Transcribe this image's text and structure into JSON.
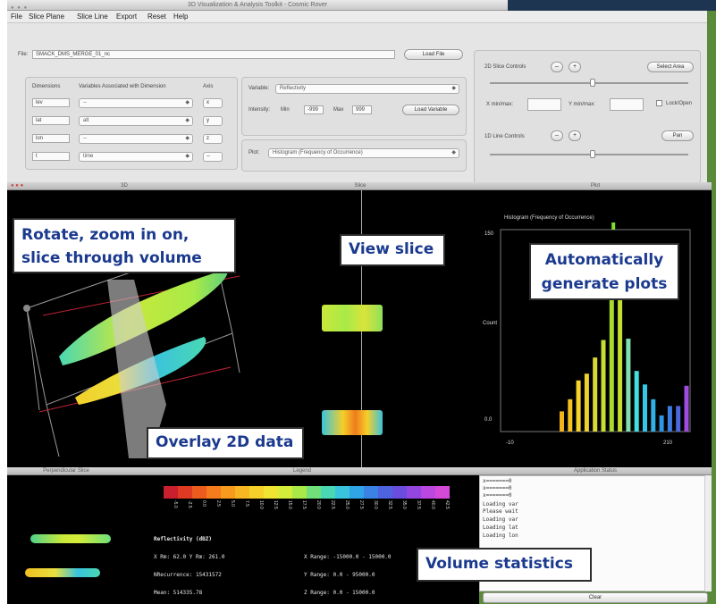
{
  "window": {
    "title": "3D Visualization & Analysis Toolkit - Cosmic Rover"
  },
  "menu": [
    "File",
    "Slice Plane",
    "Slice Line",
    "Export",
    "Reset",
    "Help"
  ],
  "file": {
    "label": "File:",
    "value": "SMACK_DMS_MERGE_01_nc",
    "load_button": "Load File"
  },
  "dims": {
    "header_dimensions": "Dimensions",
    "header_variables": "Variables Associated with Dimension",
    "header_axis": "Axis",
    "rows": [
      {
        "dim": "lev",
        "var": "--",
        "axis": "x"
      },
      {
        "dim": "lat",
        "var": "alt",
        "axis": "y"
      },
      {
        "dim": "lon",
        "var": "--",
        "axis": "z"
      },
      {
        "dim": "t",
        "var": "time",
        "axis": "--"
      }
    ]
  },
  "variable": {
    "label": "Variable:",
    "value": "Reflectivity",
    "intensity_label": "Intensity:",
    "min_label": "Min",
    "min_value": "-999",
    "max_label": "Max",
    "max_value": "999",
    "load_button": "Load Variable"
  },
  "plot": {
    "label": "Plot:",
    "value": "Histogram (Frequency of Occurrence)"
  },
  "slice2d": {
    "label": "2D Slice Controls",
    "minus": "–",
    "plus": "+",
    "button": "Select Area",
    "xmin_label": "X min/max:",
    "ymin_label": "Y min/max:",
    "lock_label": "Lock/Open"
  },
  "line1d": {
    "label": "1D Line Controls",
    "minus": "–",
    "plus": "+",
    "button": "Pan"
  },
  "panels": {
    "view3d": "3D",
    "slice": "Slice",
    "plot": "Plot",
    "perp": "Perpendicular Slice",
    "legend": "Legend",
    "status": "Application Status"
  },
  "histogram": {
    "title": "Histogram (Frequency of Occurrence)",
    "ylabel": "Count",
    "ytick_top": "150",
    "ytick_bottom": "0.0",
    "xtick_left": "-10",
    "xtick_right": "210"
  },
  "chart_data": {
    "type": "bar",
    "title": "Histogram (Frequency of Occurrence)",
    "ylabel": "Count",
    "xlim": [
      -10,
      210
    ],
    "ylim": [
      0,
      150
    ],
    "values": [
      15,
      24,
      38,
      43,
      55,
      68,
      131,
      131,
      69,
      45,
      35,
      24,
      12,
      19,
      19,
      34
    ],
    "colors": [
      "#f2b21a",
      "#f5c21f",
      "#f7d42a",
      "#ecd130",
      "#d9d936",
      "#c9de33",
      "#a8d92e",
      "#c3e02c",
      "#7fe0b0",
      "#43e0e0",
      "#33c8e8",
      "#2fb1e6",
      "#2d96e6",
      "#3b7de2",
      "#4b66de",
      "#a24be0"
    ]
  },
  "callouts": {
    "rotate": [
      "Rotate, zoom in on,",
      "slice through volume"
    ],
    "view_slice": "View slice",
    "auto_plots": [
      "Automatically",
      "generate plots"
    ],
    "overlay": "Overlay 2D data",
    "stats": "Volume statistics"
  },
  "legend": {
    "colors": [
      "#c8202c",
      "#e03a22",
      "#ee5b1e",
      "#f47c1c",
      "#f79a1e",
      "#f8b623",
      "#f5cf2a",
      "#f0e332",
      "#d4ec3a",
      "#a9ea48",
      "#6fe07a",
      "#49d8b3",
      "#39c3dd",
      "#2fa4e6",
      "#3a82e3",
      "#4d63df",
      "#6a4ddf",
      "#9347e0",
      "#bb47e0",
      "#d34ad9"
    ],
    "ticks": [
      "-5.0",
      "-2.5",
      "0.0",
      "2.5",
      "5.0",
      "7.5",
      "10.0",
      "12.5",
      "15.0",
      "17.5",
      "20.0",
      "22.5",
      "25.0",
      "27.5",
      "30.0",
      "32.5",
      "35.0",
      "37.5",
      "40.0",
      "42.5"
    ]
  },
  "stats": {
    "title": "Reflectivity (dBZ)",
    "line1": "X Rm: 62.0  Y Rm: 261.0",
    "line2": "NRecurrence: 15431572",
    "line3": "Mean: 514335.78",
    "xrange": "X Range: -15000.0 - 15000.0",
    "yrange": "Y Range: 0.0 - 95000.0",
    "zrange": "Z Range: 0.0 - 15000.0"
  },
  "status": {
    "lines": [
      "x=======0",
      "x=======0",
      "x=======0",
      "Loading var",
      "Please wait",
      "Loading var",
      "Loading lat",
      "Loading lon"
    ],
    "clear_button": "Clear"
  }
}
